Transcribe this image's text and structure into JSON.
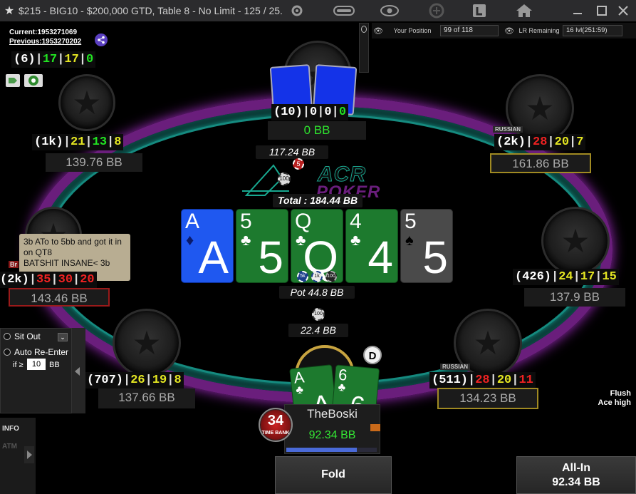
{
  "window": {
    "title": "$215 - BIG10 - $200,000 GTD, Table 8 - No Limit - 125 / 25...",
    "star_glyph": "★"
  },
  "infobar": {
    "position_label": "Your Position",
    "position_value": "99 of 118",
    "lr_label": "LR Remaining",
    "lr_value": "16 lvl(251:59)"
  },
  "hand": {
    "current_label": "Current:1953271069",
    "previous_label": "Previous:1953270202"
  },
  "self_hud": {
    "hands": "(6)",
    "a": "17",
    "b": "17",
    "c": "0"
  },
  "seats": {
    "top": {
      "hud_hands": "(10)",
      "a": "0",
      "b": "0",
      "c": "0",
      "stack": "0 BB",
      "bet": "117.24 BB"
    },
    "top_left": {
      "hud_hands": "(1k)",
      "a": "21",
      "b": "13",
      "c": "8",
      "stack": "139.76 BB"
    },
    "top_right": {
      "tag": "RUSSIAN",
      "hud_hands": "(2k)",
      "a": "28",
      "b": "20",
      "c": "7",
      "stack": "161.86 BB"
    },
    "left": {
      "tag": "Br",
      "hud_hands": "(2k)",
      "a": "35",
      "b": "30",
      "c": "20",
      "stack": "143.46 BB"
    },
    "right": {
      "hud_hands": "(426)",
      "a": "24",
      "b": "17",
      "c": "15",
      "stack": "137.9 BB"
    },
    "bottom_left": {
      "hud_hands": "(707)",
      "a": "26",
      "b": "19",
      "c": "8",
      "stack": "137.66 BB"
    },
    "bottom_right": {
      "tag": "RUSSIAN",
      "hud_hands": "(511)",
      "a": "28",
      "b": "20",
      "c": "11",
      "stack": "134.23 BB"
    },
    "hero": {
      "name": "TheBoski",
      "stack": "92.34 BB",
      "bet": "22.4 BB",
      "timebank": "34",
      "timebank_label": "TIME BANK",
      "dealer": "D",
      "card1_rank": "A",
      "card2_rank": "6",
      "card1_big": "A",
      "card2_big": "6"
    }
  },
  "logo": {
    "line1": "ACR",
    "line2": "POKER"
  },
  "pot": {
    "total": "Total : 184.44 BB",
    "pot": "Pot 44.8 BB",
    "chip1": "5k",
    "chip2": "1k",
    "chip3": "100"
  },
  "board": [
    {
      "rank": "A",
      "suit": "♦",
      "color": "blue"
    },
    {
      "rank": "5",
      "suit": "♣",
      "color": "green"
    },
    {
      "rank": "Q",
      "suit": "♣",
      "color": "green"
    },
    {
      "rank": "4",
      "suit": "♣",
      "color": "green"
    },
    {
      "rank": "5",
      "suit": "♠",
      "color": "grey"
    }
  ],
  "note_text": "3b ATo to 5bb and got it in on QT8\nBATSHIT INSANE< 3b",
  "left_panel": {
    "sit_out": "Sit Out",
    "auto_reenter": "Auto Re-Enter",
    "if_label": "if ≥",
    "bb_value": "10",
    "bb_label": "BB"
  },
  "side_tabs": {
    "info": "INFO",
    "atm": "ATM"
  },
  "hand_strength": {
    "line1": "Flush",
    "line2": "Ace high"
  },
  "actions": {
    "fold": "Fold",
    "allin": "All-In",
    "allin_amount": "92.34 BB"
  },
  "chip_top": "5",
  "chip_top2": "100",
  "chip_hero": "100",
  "colors": {
    "felt_purple": "#6a1e7c",
    "felt_teal": "#158a7f",
    "card_green": "#1d7a2e",
    "card_blue": "#1f58f0"
  }
}
